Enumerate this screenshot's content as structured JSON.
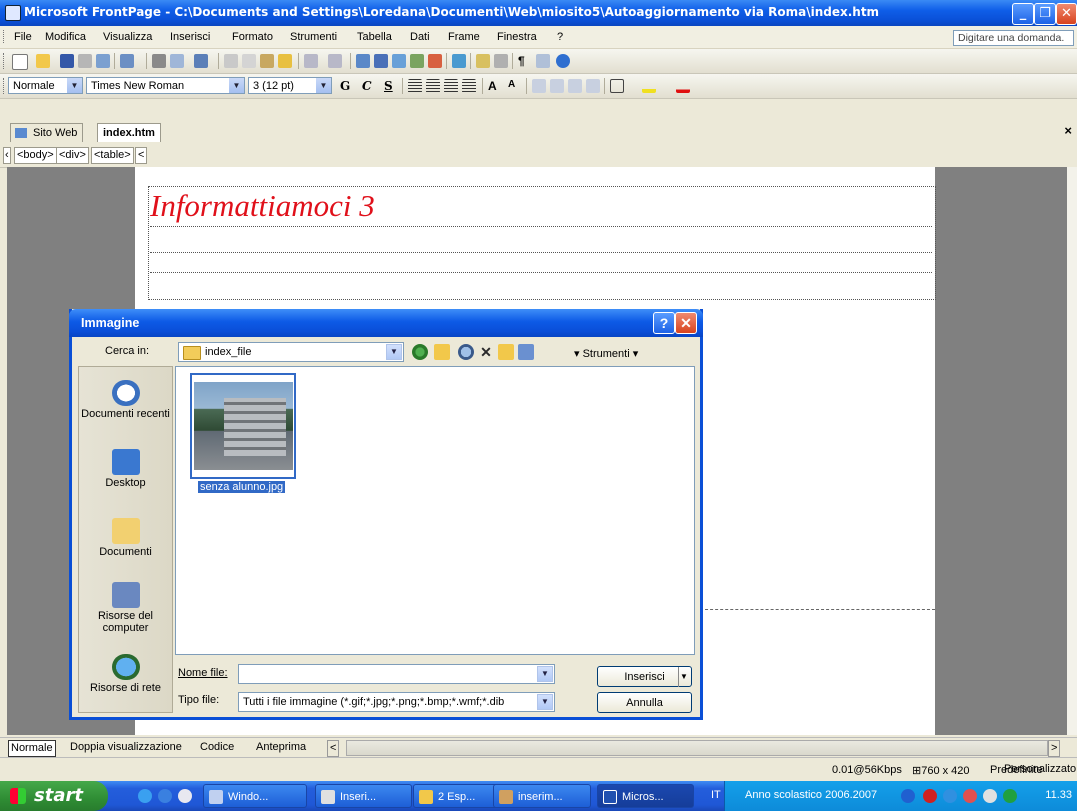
{
  "window": {
    "title": "Microsoft FrontPage - C:\\Documents and Settings\\Loredana\\Documenti\\Web\\miosito5\\Autoaggiornamento via Roma\\index.htm"
  },
  "menu": {
    "items": [
      "File",
      "Modifica",
      "Visualizza",
      "Inserisci",
      "Formato",
      "Strumenti",
      "Tabella",
      "Dati",
      "Frame",
      "Finestra",
      "?"
    ],
    "ask_placeholder": "Digitare una domanda."
  },
  "format_bar": {
    "style": "Normale",
    "font": "Times New Roman",
    "size": "3 (12 pt)",
    "bold": "G",
    "italic": "C",
    "underline": "S"
  },
  "tabs": {
    "site": "Sito Web",
    "file": "index.htm"
  },
  "tags": [
    "<body>",
    "<div>",
    "<table>",
    "<"
  ],
  "page": {
    "heading": "Informattiamoci 3"
  },
  "views": {
    "normal": "Normale",
    "split": "Doppia visualizzazione",
    "code": "Codice",
    "preview": "Anteprima"
  },
  "status": {
    "speed": "0.01@56Kbps",
    "size": "760 x 420",
    "mode": "Predefinite",
    "custom": "Personalizzato"
  },
  "dialog": {
    "title": "Immagine",
    "look_in_label": "Cerca in:",
    "look_in_value": "index_file",
    "tools_label": "Strumenti",
    "places": [
      "Documenti recenti",
      "Desktop",
      "Documenti",
      "Risorse del computer",
      "Risorse di rete"
    ],
    "file_name": "senza alunno.jpg",
    "file_name_label": "Nome file:",
    "file_name_value": "",
    "file_type_label": "Tipo file:",
    "file_type_value": "Tutti i file immagine (*.gif;*.jpg;*.png;*.bmp;*.wmf;*.dib",
    "insert_button": "Inserisci",
    "cancel_button": "Annulla"
  },
  "taskbar": {
    "start": "start",
    "tasks": [
      "Windo...",
      "Inseri...",
      "2 Esp...",
      "inserim...",
      "Micros..."
    ],
    "lang": "IT",
    "tray_text": "Anno scolastico 2006.2007",
    "clock": "11.33"
  }
}
